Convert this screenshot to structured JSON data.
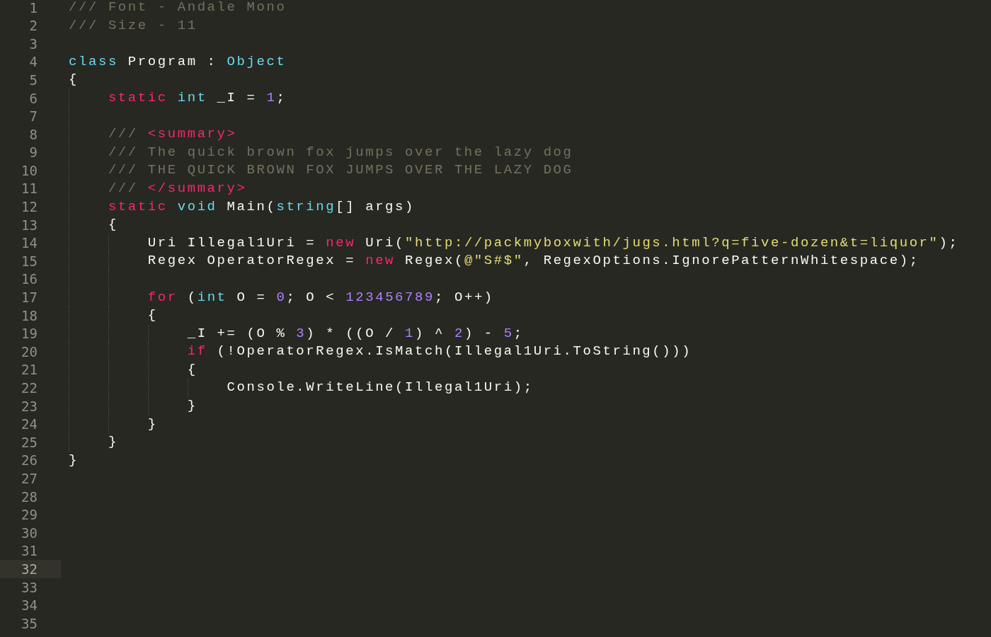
{
  "editor": {
    "lines": [
      {
        "number": "1",
        "current": false,
        "tokens": [
          {
            "kind": "comment",
            "text": "/// Font - Andale Mono"
          }
        ]
      },
      {
        "number": "2",
        "current": false,
        "tokens": [
          {
            "kind": "comment",
            "text": "/// Size - 11"
          }
        ]
      },
      {
        "number": "3",
        "current": false
      },
      {
        "number": "4",
        "current": false,
        "tokens": [
          {
            "kind": "type",
            "text": "class"
          },
          {
            "kind": "plain",
            "text": " Program : "
          },
          {
            "kind": "type",
            "text": "Object"
          }
        ]
      },
      {
        "number": "5",
        "current": false,
        "tokens": [
          {
            "kind": "plain",
            "text": "{"
          }
        ]
      },
      {
        "number": "6",
        "current": false,
        "tokens": [
          {
            "kind": "keyword",
            "text": "    static"
          },
          {
            "kind": "type",
            "text": " int"
          },
          {
            "kind": "plain",
            "text": " _I = "
          },
          {
            "kind": "number",
            "text": "1"
          },
          {
            "kind": "plain",
            "text": ";"
          }
        ]
      },
      {
        "number": "7",
        "current": false
      },
      {
        "number": "8",
        "current": false,
        "tokens": [
          {
            "kind": "comment",
            "text": "    /// "
          },
          {
            "kind": "keyword",
            "text": "<summary>"
          }
        ]
      },
      {
        "number": "9",
        "current": false,
        "tokens": [
          {
            "kind": "comment",
            "text": "    /// The quick brown fox jumps over the lazy dog"
          }
        ]
      },
      {
        "number": "10",
        "current": false,
        "tokens": [
          {
            "kind": "comment",
            "text": "    /// THE QUICK BROWN FOX JUMPS OVER THE LAZY DOG"
          }
        ]
      },
      {
        "number": "11",
        "current": false,
        "tokens": [
          {
            "kind": "comment",
            "text": "    /// "
          },
          {
            "kind": "keyword",
            "text": "</summary>"
          }
        ]
      },
      {
        "number": "12",
        "current": false,
        "tokens": [
          {
            "kind": "keyword",
            "text": "    static"
          },
          {
            "kind": "type",
            "text": " void"
          },
          {
            "kind": "plain",
            "text": " Main("
          },
          {
            "kind": "type",
            "text": "string"
          },
          {
            "kind": "plain",
            "text": "[] args)"
          }
        ]
      },
      {
        "number": "13",
        "current": false,
        "tokens": [
          {
            "kind": "plain",
            "text": "    {"
          }
        ]
      },
      {
        "number": "14",
        "current": false,
        "tokens": [
          {
            "kind": "plain",
            "text": "        Uri Illegal1Uri = "
          },
          {
            "kind": "keyword",
            "text": "new"
          },
          {
            "kind": "plain",
            "text": " Uri("
          },
          {
            "kind": "string",
            "text": "\"http://packmyboxwith/jugs.html?q=five-dozen&t=liquor\""
          },
          {
            "kind": "plain",
            "text": ");"
          }
        ]
      },
      {
        "number": "15",
        "current": false,
        "tokens": [
          {
            "kind": "plain",
            "text": "        Regex OperatorRegex = "
          },
          {
            "kind": "keyword",
            "text": "new"
          },
          {
            "kind": "plain",
            "text": " Regex("
          },
          {
            "kind": "string",
            "text": "@\"S#$\""
          },
          {
            "kind": "plain",
            "text": ", RegexOptions.IgnorePatternWhitespace);"
          }
        ]
      },
      {
        "number": "16",
        "current": false
      },
      {
        "number": "17",
        "current": false,
        "tokens": [
          {
            "kind": "keyword",
            "text": "        for"
          },
          {
            "kind": "plain",
            "text": " ("
          },
          {
            "kind": "type",
            "text": "int"
          },
          {
            "kind": "plain",
            "text": " O = "
          },
          {
            "kind": "number",
            "text": "0"
          },
          {
            "kind": "plain",
            "text": "; O < "
          },
          {
            "kind": "number",
            "text": "123456789"
          },
          {
            "kind": "plain",
            "text": "; O++)"
          }
        ]
      },
      {
        "number": "18",
        "current": false,
        "tokens": [
          {
            "kind": "plain",
            "text": "        {"
          }
        ]
      },
      {
        "number": "19",
        "current": false,
        "tokens": [
          {
            "kind": "plain",
            "text": "            _I += (O % "
          },
          {
            "kind": "number",
            "text": "3"
          },
          {
            "kind": "plain",
            "text": ") * ((O / "
          },
          {
            "kind": "number",
            "text": "1"
          },
          {
            "kind": "plain",
            "text": ") ^ "
          },
          {
            "kind": "number",
            "text": "2"
          },
          {
            "kind": "plain",
            "text": ") - "
          },
          {
            "kind": "number",
            "text": "5"
          },
          {
            "kind": "plain",
            "text": ";"
          }
        ]
      },
      {
        "number": "20",
        "current": false,
        "tokens": [
          {
            "kind": "keyword",
            "text": "            if"
          },
          {
            "kind": "plain",
            "text": " (!OperatorRegex.IsMatch(Illegal1Uri.ToString()))"
          }
        ]
      },
      {
        "number": "21",
        "current": false,
        "tokens": [
          {
            "kind": "plain",
            "text": "            {"
          }
        ]
      },
      {
        "number": "22",
        "current": false,
        "tokens": [
          {
            "kind": "plain",
            "text": "                Console.WriteLine(Illegal1Uri);"
          }
        ]
      },
      {
        "number": "23",
        "current": false,
        "tokens": [
          {
            "kind": "plain",
            "text": "            }"
          }
        ]
      },
      {
        "number": "24",
        "current": false,
        "tokens": [
          {
            "kind": "plain",
            "text": "        }"
          }
        ]
      },
      {
        "number": "25",
        "current": false,
        "tokens": [
          {
            "kind": "plain",
            "text": "    }"
          }
        ]
      },
      {
        "number": "26",
        "current": false,
        "tokens": [
          {
            "kind": "plain",
            "text": "}"
          }
        ]
      },
      {
        "number": "27",
        "current": false
      },
      {
        "number": "28",
        "current": false
      },
      {
        "number": "29",
        "current": false
      },
      {
        "number": "30",
        "current": false
      },
      {
        "number": "31",
        "current": false
      },
      {
        "number": "32",
        "current": true
      },
      {
        "number": "33",
        "current": false
      },
      {
        "number": "34",
        "current": false
      },
      {
        "number": "35",
        "current": false
      }
    ]
  }
}
